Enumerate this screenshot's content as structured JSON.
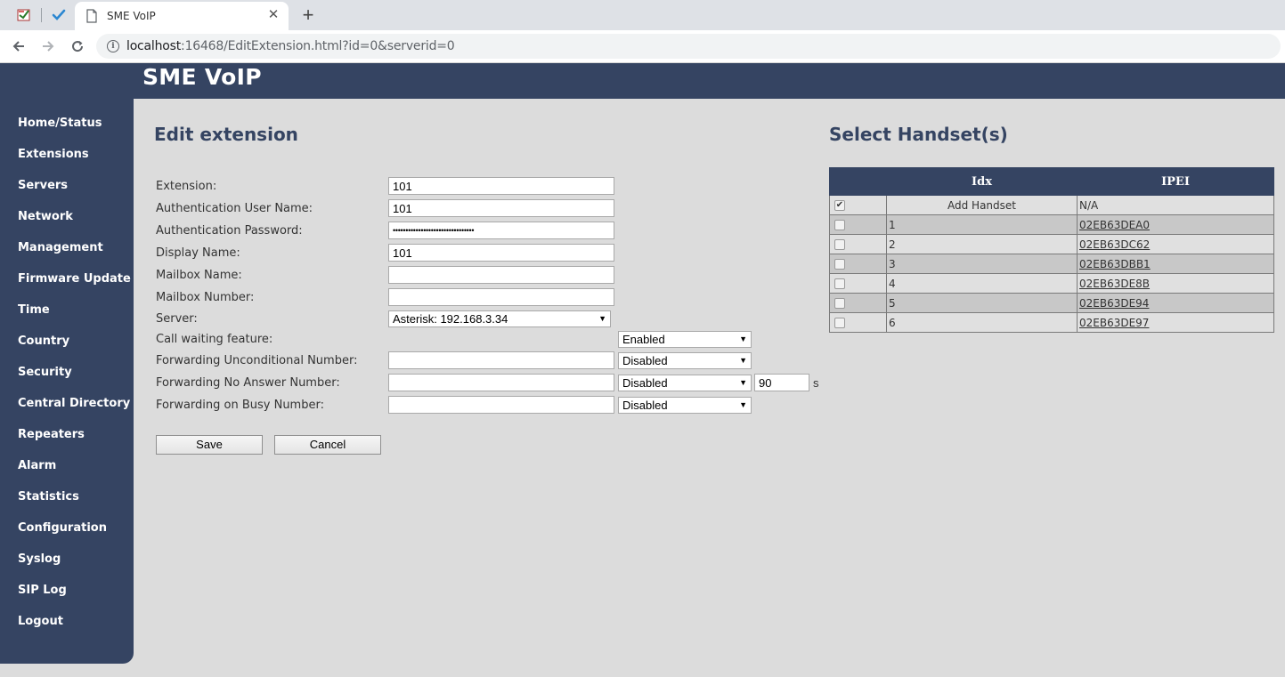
{
  "browser": {
    "tab_title": "SME VoIP",
    "tab_close": "✕",
    "new_tab": "+",
    "url_host": "localhost",
    "url_rest": ":16468/EditExtension.html?id=0&serverid=0"
  },
  "app": {
    "title": "SME VoIP",
    "accent_color": "#354462"
  },
  "sidebar": {
    "items": [
      {
        "label": "Home/Status"
      },
      {
        "label": "Extensions"
      },
      {
        "label": "Servers"
      },
      {
        "label": "Network"
      },
      {
        "label": "Management"
      },
      {
        "label": "Firmware Update"
      },
      {
        "label": "Time"
      },
      {
        "label": "Country"
      },
      {
        "label": "Security"
      },
      {
        "label": "Central Directory"
      },
      {
        "label": "Repeaters"
      },
      {
        "label": "Alarm"
      },
      {
        "label": "Statistics"
      },
      {
        "label": "Configuration"
      },
      {
        "label": "Syslog"
      },
      {
        "label": "SIP Log"
      },
      {
        "label": "Logout"
      }
    ]
  },
  "form": {
    "heading": "Edit extension",
    "extension": {
      "label": "Extension:",
      "value": "101"
    },
    "auth_user": {
      "label": "Authentication User Name:",
      "value": "101"
    },
    "auth_password": {
      "label": "Authentication Password:",
      "value": "••••••••••••••••••••••••••••••••"
    },
    "display_name": {
      "label": "Display Name:",
      "value": "101"
    },
    "mailbox_name": {
      "label": "Mailbox Name:",
      "value": ""
    },
    "mailbox_number": {
      "label": "Mailbox Number:",
      "value": ""
    },
    "server": {
      "label": "Server:",
      "selected": "Asterisk: 192.168.3.34"
    },
    "call_waiting": {
      "label": "Call waiting feature:",
      "selected": "Enabled"
    },
    "fwd_unconditional": {
      "label": "Forwarding Unconditional Number:",
      "value": "",
      "mode": "Disabled"
    },
    "fwd_no_answer": {
      "label": "Forwarding No Answer Number:",
      "value": "",
      "mode": "Disabled",
      "timeout": "90",
      "timeout_unit": "s"
    },
    "fwd_busy": {
      "label": "Forwarding on Busy Number:",
      "value": "",
      "mode": "Disabled"
    },
    "save_label": "Save",
    "cancel_label": "Cancel"
  },
  "handsets": {
    "heading": "Select Handset(s)",
    "col_idx": "Idx",
    "col_ipei": "IPEI",
    "add_row": {
      "label": "Add Handset",
      "ipei": "N/A",
      "checked": true
    },
    "rows": [
      {
        "idx": "1",
        "ipei": "02EB63DEA0"
      },
      {
        "idx": "2",
        "ipei": "02EB63DC62"
      },
      {
        "idx": "3",
        "ipei": "02EB63DBB1"
      },
      {
        "idx": "4",
        "ipei": "02EB63DE8B"
      },
      {
        "idx": "5",
        "ipei": "02EB63DE94"
      },
      {
        "idx": "6",
        "ipei": "02EB63DE97"
      }
    ]
  }
}
